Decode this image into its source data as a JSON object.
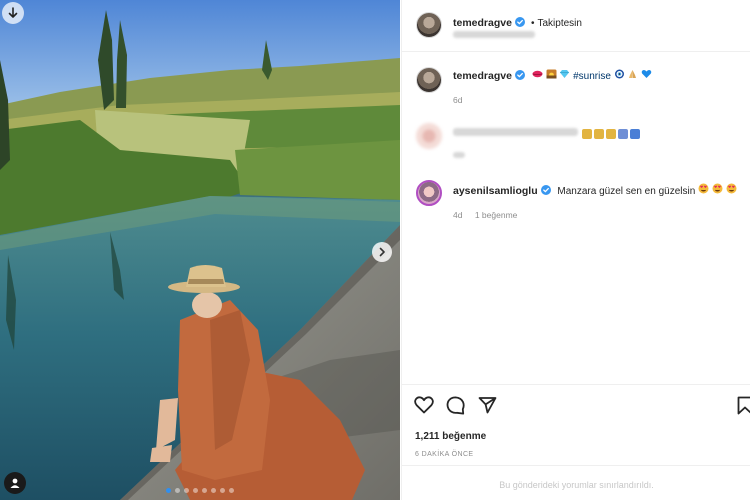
{
  "post": {
    "author": "temedragve",
    "follow_status": "Takiptesin",
    "separator": "•"
  },
  "caption": {
    "username": "temedragve",
    "hashtag": "#sunrise",
    "time": "6d",
    "emoji_before": [
      "lips-emoji",
      "sunrise-emoji",
      "diamond-emoji"
    ],
    "emoji_after": [
      "evil-eye-emoji",
      "praying-hands-emoji",
      "blue-heart-emoji"
    ]
  },
  "comments": [
    {
      "username": "aysenilsamlioglu",
      "text": "Manzara güzel sen en güzelsin",
      "time": "4d",
      "likes": "1 beğenme",
      "emoji": [
        "heart-eyes-emoji",
        "heart-eyes-emoji",
        "heart-eyes-emoji"
      ]
    }
  ],
  "stats": {
    "likes": "1,211 beğenme",
    "posted_ago": "6 DAKİKA ÖNCE"
  },
  "footer": {
    "restricted_text": "Bu gönderideki yorumlar sınırlandırıldı."
  },
  "carousel": {
    "total": 8,
    "current": 1
  },
  "colors": {
    "verified": "#3897f0",
    "hashtag": "#00376b",
    "story_ring": "#b04ec2",
    "carousel_active": "#2f8ff0"
  }
}
